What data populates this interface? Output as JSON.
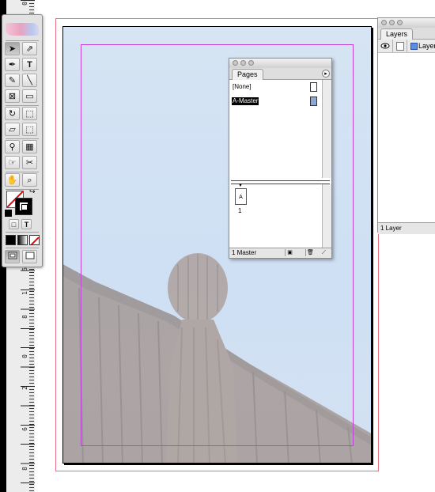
{
  "ruler": {
    "numbers": [
      "0",
      "1",
      "6",
      "8",
      "7",
      "0",
      "2",
      "4",
      "6",
      "8",
      "10",
      "1",
      "6",
      "0",
      "1",
      "8",
      "0",
      "2",
      "0",
      "0",
      "2",
      "2",
      "0",
      "2",
      "4",
      "0",
      "2",
      "6",
      "0",
      "2",
      "8",
      "0",
      "3",
      "0",
      "0"
    ]
  },
  "tools": {
    "items": [
      {
        "name": "selection-tool-icon",
        "glyph": "➤"
      },
      {
        "name": "direct-selection-tool-icon",
        "glyph": "⇗"
      },
      {
        "name": "pen-tool-icon",
        "glyph": "✒"
      },
      {
        "name": "type-tool-icon",
        "glyph": "T"
      },
      {
        "name": "pencil-tool-icon",
        "glyph": "✎"
      },
      {
        "name": "line-tool-icon",
        "glyph": "╲"
      },
      {
        "name": "rectangle-frame-tool-icon",
        "glyph": "⊠"
      },
      {
        "name": "rectangle-tool-icon",
        "glyph": "▭"
      },
      {
        "name": "rotate-tool-icon",
        "glyph": "↻"
      },
      {
        "name": "scale-tool-icon",
        "glyph": "⬚"
      },
      {
        "name": "shear-tool-icon",
        "glyph": "▱"
      },
      {
        "name": "free-transform-tool-icon",
        "glyph": "⬚"
      },
      {
        "name": "eyedropper-tool-icon",
        "glyph": "⚲"
      },
      {
        "name": "gradient-tool-icon",
        "glyph": "▦"
      },
      {
        "name": "button-tool-icon",
        "glyph": "☞"
      },
      {
        "name": "scissors-tool-icon",
        "glyph": "✂"
      },
      {
        "name": "hand-tool-icon",
        "glyph": "✋"
      },
      {
        "name": "zoom-tool-icon",
        "glyph": "⌕"
      }
    ],
    "format_container": "□",
    "format_text": "T"
  },
  "pages_panel": {
    "tab_label": "Pages",
    "none_label": "[None]",
    "master_label": "A-Master",
    "page_thumb_letter": "A",
    "page_number": "1",
    "footer_label": "1 Master",
    "menu_glyph": "▸"
  },
  "layers_panel": {
    "tab_label": "Layers",
    "layer_name": "Layer",
    "footer_label": "1 Layer",
    "layer_color": "#5b8ee0"
  },
  "colors": {
    "bleed_guide": "#e86e80",
    "margin_guide": "#c040d8",
    "sky": "#d6e4f3",
    "sculpture": "#8e7466"
  }
}
